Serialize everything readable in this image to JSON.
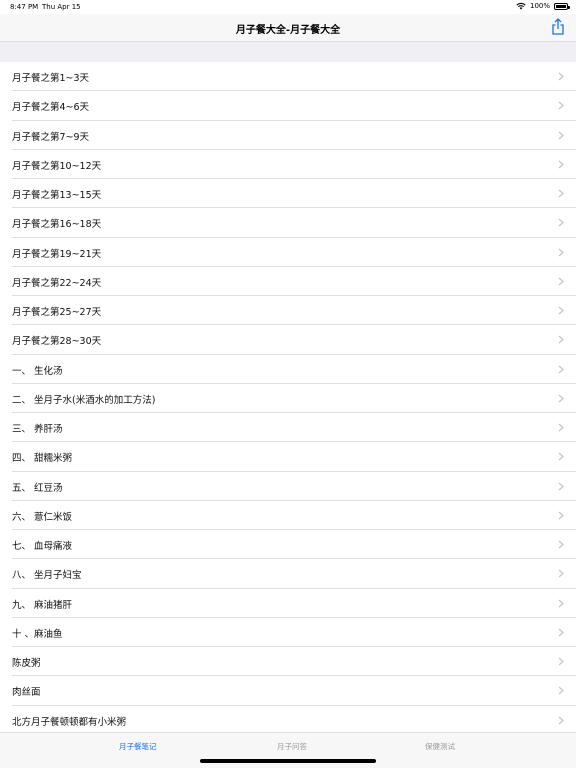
{
  "status_bar": {
    "time": "8:47 PM",
    "date": "Thu Apr 15",
    "battery": "100%"
  },
  "nav": {
    "title": "月子餐大全-月子餐大全"
  },
  "list": {
    "items": [
      "月子餐之第1~3天",
      "月子餐之第4~6天",
      "月子餐之第7~9天",
      "月子餐之第10~12天",
      "月子餐之第13~15天",
      "月子餐之第16~18天",
      "月子餐之第19~21天",
      "月子餐之第22~24天",
      "月子餐之第25~27天",
      "月子餐之第28~30天",
      "一、 生化汤",
      "二、 坐月子水(米酒水的加工方法)",
      "三、 养肝汤",
      "四、 甜糯米粥",
      "五、 红豆汤",
      "六、 薏仁米饭",
      "七、 血母痛液",
      "八、 坐月子妇宝",
      "九、 麻油猪肝",
      "十 、麻油鱼",
      "陈皮粥",
      "肉丝面",
      "北方月子餐顿顿都有小米粥"
    ]
  },
  "tabs": [
    {
      "label": "月子餐笔记",
      "active": true
    },
    {
      "label": "月子问答",
      "active": false
    },
    {
      "label": "保健测试",
      "active": false
    }
  ],
  "colors": {
    "accent": "#1a73e8",
    "inactive_tab": "#9b9b9b"
  }
}
